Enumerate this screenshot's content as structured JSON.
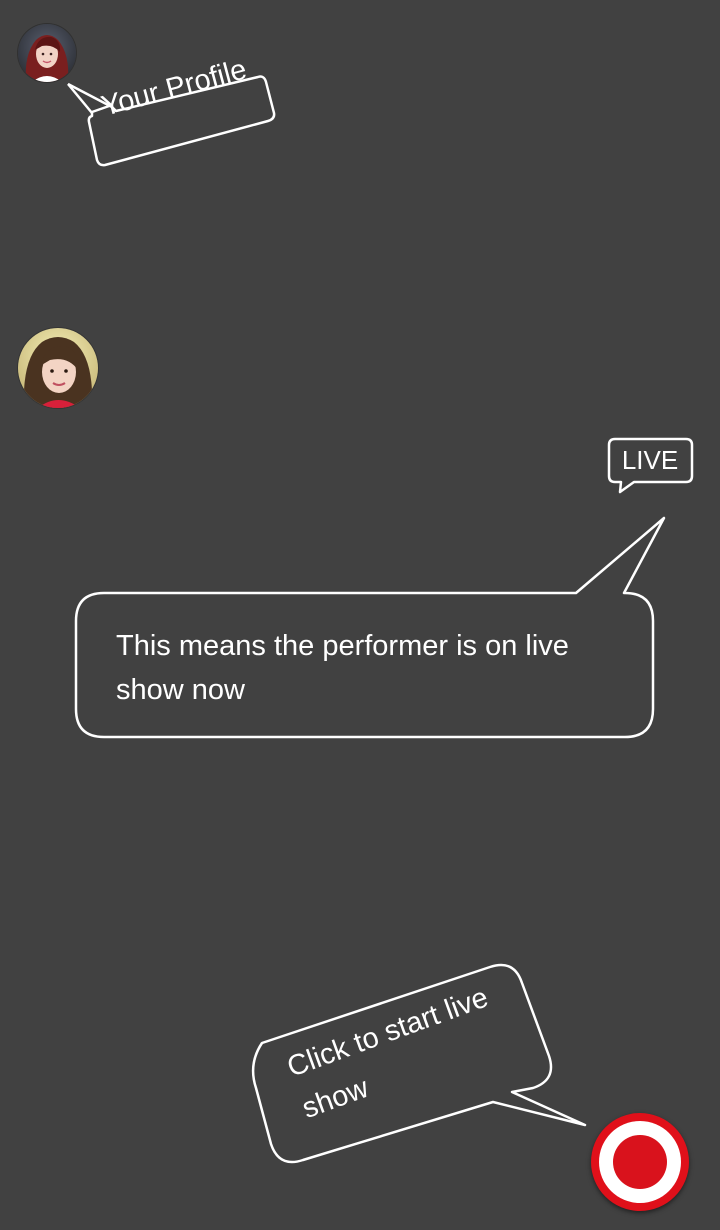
{
  "colors": {
    "background": "#414141",
    "callout_stroke": "#ffffff",
    "record_red": "#e0101a"
  },
  "profile_callout": {
    "avatar_icon": "user-avatar",
    "label": "Your Profile"
  },
  "performer": {
    "avatar_icon": "performer-avatar"
  },
  "live_badge": {
    "label": "LIVE"
  },
  "live_callout": {
    "text": "This means the performer is on live show now"
  },
  "start_callout": {
    "text": "Click to start live show"
  },
  "record_button": {
    "icon": "record-icon"
  }
}
